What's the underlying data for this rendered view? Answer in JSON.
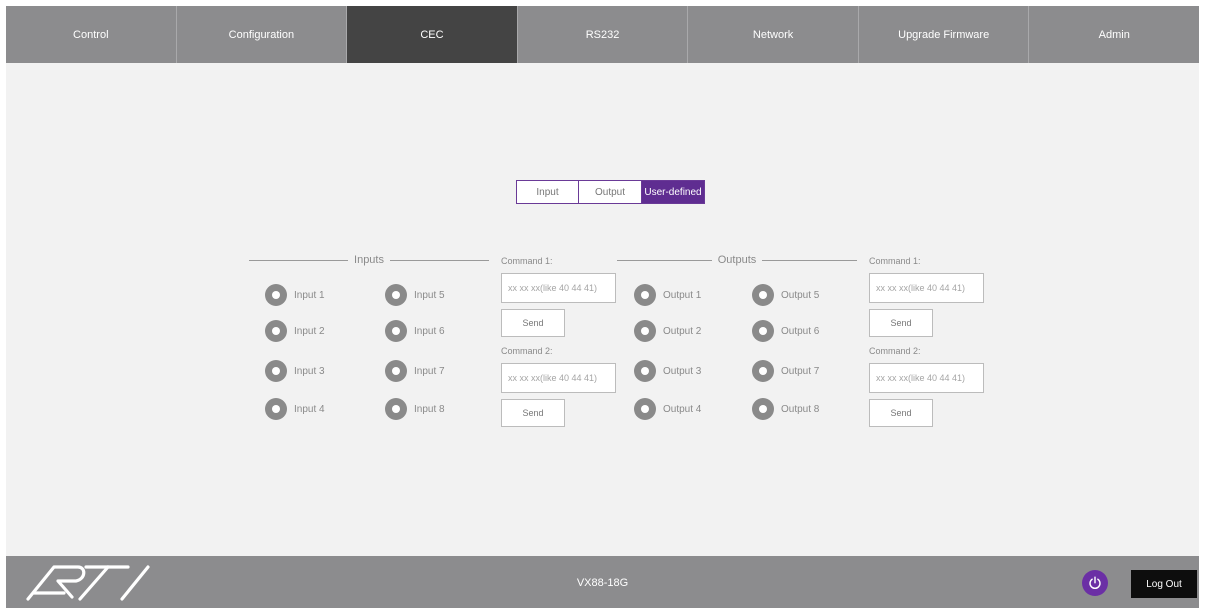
{
  "nav": {
    "tabs": [
      {
        "label": "Control"
      },
      {
        "label": "Configuration"
      },
      {
        "label": "CEC"
      },
      {
        "label": "RS232"
      },
      {
        "label": "Network"
      },
      {
        "label": "Upgrade Firmware"
      },
      {
        "label": "Admin"
      }
    ],
    "active": "CEC"
  },
  "mode_switch": {
    "items": [
      {
        "label": "Input"
      },
      {
        "label": "Output"
      },
      {
        "label": "User-defined"
      }
    ],
    "active": "User-defined"
  },
  "inputs": {
    "heading": "Inputs",
    "items": [
      "Input 1",
      "Input 2",
      "Input 3",
      "Input 4",
      "Input 5",
      "Input 6",
      "Input 7",
      "Input 8"
    ],
    "command1": {
      "label": "Command 1:",
      "placeholder": "xx xx xx(like 40 44 41)",
      "value": "",
      "send_label": "Send"
    },
    "command2": {
      "label": "Command 2:",
      "placeholder": "xx xx xx(like 40 44 41)",
      "value": "",
      "send_label": "Send"
    }
  },
  "outputs": {
    "heading": "Outputs",
    "items": [
      "Output 1",
      "Output 2",
      "Output 3",
      "Output 4",
      "Output 5",
      "Output 6",
      "Output 7",
      "Output 8"
    ],
    "command1": {
      "label": "Command 1:",
      "placeholder": "xx xx xx(like 40 44 41)",
      "value": "",
      "send_label": "Send"
    },
    "command2": {
      "label": "Command 2:",
      "placeholder": "xx xx xx(like 40 44 41)",
      "value": "",
      "send_label": "Send"
    }
  },
  "footer": {
    "logo": "RTI",
    "model": "VX88-18G",
    "power_icon": "power-icon",
    "logout_label": "Log Out"
  },
  "colors": {
    "accent": "#5f2d91",
    "bar": "#8c8c8e",
    "active_tab": "#444444",
    "background": "#f2f2f2"
  }
}
